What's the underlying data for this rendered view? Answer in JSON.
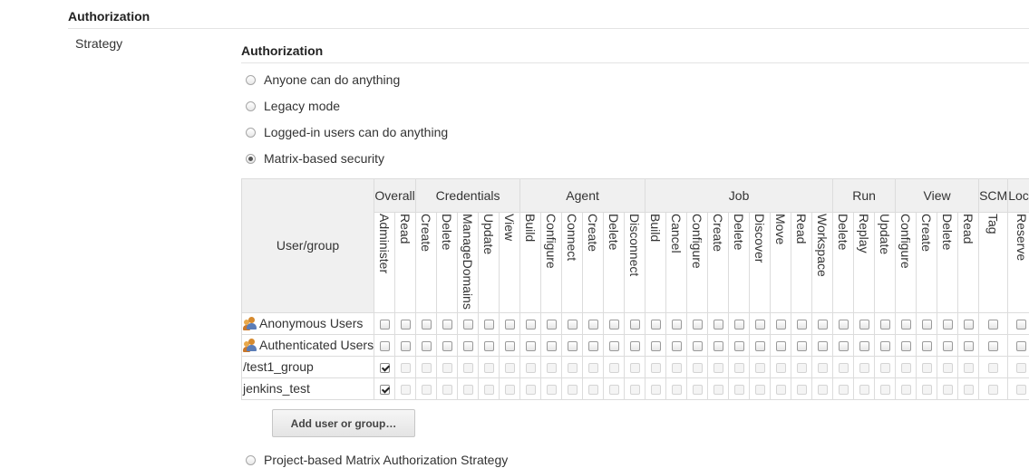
{
  "section": {
    "title": "Authorization"
  },
  "strategy": {
    "label": "Strategy"
  },
  "authorization": {
    "title": "Authorization",
    "options": [
      {
        "label": "Anyone can do anything",
        "checked": false
      },
      {
        "label": "Legacy mode",
        "checked": false
      },
      {
        "label": "Logged-in users can do anything",
        "checked": false
      },
      {
        "label": "Matrix-based security",
        "checked": true
      }
    ],
    "last_option": {
      "label": "Project-based Matrix Authorization Strategy",
      "checked": false
    }
  },
  "matrix": {
    "user_group_header": "User/group",
    "categories": [
      {
        "name": "Overall",
        "span": 2
      },
      {
        "name": "Credentials",
        "span": 5
      },
      {
        "name": "Agent",
        "span": 6
      },
      {
        "name": "Job",
        "span": 9
      },
      {
        "name": "Run",
        "span": 3
      },
      {
        "name": "View",
        "span": 4
      },
      {
        "name": "SCM",
        "span": 1
      },
      {
        "name": "Lock",
        "span": 1
      }
    ],
    "permissions": [
      "Administer",
      "Read",
      "Create",
      "Delete",
      "ManageDomains",
      "Update",
      "View",
      "Build",
      "Configure",
      "Connect",
      "Create",
      "Delete",
      "Disconnect",
      "Build",
      "Cancel",
      "Configure",
      "Create",
      "Delete",
      "Discover",
      "Move",
      "Read",
      "Workspace",
      "Delete",
      "Replay",
      "Update",
      "Configure",
      "Create",
      "Delete",
      "Read",
      "Tag",
      "Reserve"
    ],
    "rows": [
      {
        "name": "Anonymous Users",
        "icon": "user-group-icon",
        "administer": false,
        "others_disabled": false
      },
      {
        "name": "Authenticated Users",
        "icon": "user-group-icon",
        "administer": false,
        "others_disabled": false
      },
      {
        "name": "/test1_group",
        "icon": "",
        "administer": true,
        "others_disabled": true
      },
      {
        "name": "jenkins_test",
        "icon": "",
        "administer": true,
        "others_disabled": true
      }
    ]
  },
  "buttons": {
    "add_user_group": "Add user or group…"
  }
}
